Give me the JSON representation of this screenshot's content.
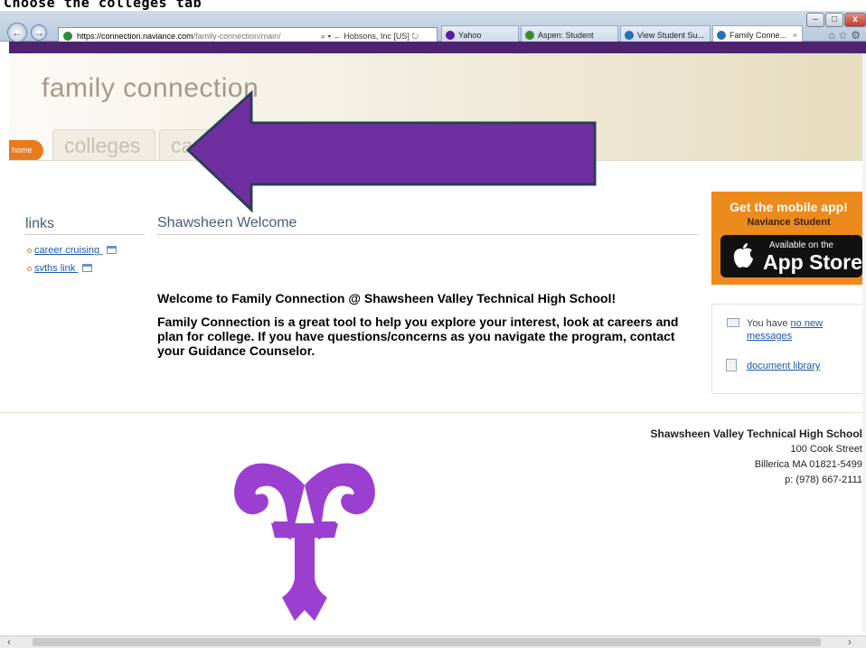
{
  "caption": "Choose the colleges tab",
  "browser": {
    "url_domain": "https://connection.naviance.com",
    "url_path": "/family-connection/main/",
    "url_tools": "⌕ ▾ ← Hobsons, Inc [US] ↻",
    "tabs": [
      {
        "label": "Yahoo",
        "color": "#5c1a9c"
      },
      {
        "label": "Aspen: Student",
        "color": "#3c8a30"
      },
      {
        "label": "View Student Su...",
        "color": "#2c6fb5"
      },
      {
        "label": "Family Conne...",
        "color": "#2c6fb5"
      }
    ],
    "tab_close": "×",
    "back": "←",
    "forward": "→",
    "window_controls": [
      "–",
      "□",
      "x"
    ],
    "chrome_icons": "⌂ ☆ ⚙"
  },
  "header": {
    "brand": "family connection",
    "home_label": "home",
    "nav_tabs": [
      {
        "label": "colleges"
      },
      {
        "label": "careers"
      }
    ]
  },
  "links": {
    "title": "links",
    "items": [
      {
        "label": "career cruising"
      },
      {
        "label": "svths link"
      }
    ]
  },
  "welcome": {
    "title": "Shawsheen Welcome",
    "heading": "Welcome to Family Connection @ Shawsheen Valley Technical High School!",
    "body": "Family Connection is a great tool to help you explore your interest, look at careers and plan for college.  If you have questions/concerns as you navigate the program, contact your Guidance Counselor."
  },
  "promo": {
    "line1": "Get the mobile app!",
    "line2": "Naviance Student",
    "badge_small": "Available on the",
    "badge_big": "App Store"
  },
  "messages": {
    "prefix": "You have",
    "link": "no new messages",
    "doc_link": "document library"
  },
  "school": {
    "name": "Shawsheen Valley Technical High School",
    "street": "100 Cook Street",
    "city": "Billerica MA 01821-5499",
    "phone": "p: (978) 667-2111"
  },
  "colors": {
    "purple": "#6f2fa1",
    "orange": "#ed8a1c",
    "ram": "#9b3fd0"
  }
}
